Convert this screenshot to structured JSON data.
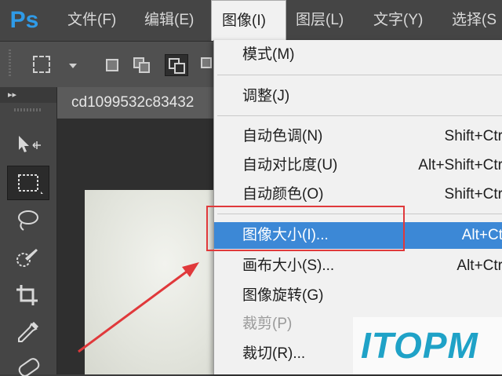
{
  "app": {
    "logo": "Ps"
  },
  "menubar": {
    "items": [
      {
        "label": "文件(F)"
      },
      {
        "label": "编辑(E)"
      },
      {
        "label": "图像(I)"
      },
      {
        "label": "图层(L)"
      },
      {
        "label": "文字(Y)"
      },
      {
        "label": "选择(S"
      }
    ],
    "active_index": 2
  },
  "panel": {
    "collapse_glyph": "▸▸"
  },
  "document": {
    "tab_title": "cd1099532c83432"
  },
  "image_menu": {
    "items": [
      {
        "label": "模式(M)",
        "shortcut": ""
      },
      {
        "label": "调整(J)",
        "shortcut": ""
      },
      {
        "label": "自动色调(N)",
        "shortcut": "Shift+Ctr"
      },
      {
        "label": "自动对比度(U)",
        "shortcut": "Alt+Shift+Ctr"
      },
      {
        "label": "自动颜色(O)",
        "shortcut": "Shift+Ctr"
      },
      {
        "label": "图像大小(I)...",
        "shortcut": "Alt+Ct",
        "highlighted": true
      },
      {
        "label": "画布大小(S)...",
        "shortcut": "Alt+Ctr"
      },
      {
        "label": "图像旋转(G)",
        "shortcut": ""
      },
      {
        "label": "裁剪(P)",
        "shortcut": "",
        "disabled": true
      },
      {
        "label": "裁切(R)...",
        "shortcut": ""
      }
    ]
  },
  "colors": {
    "highlight": "#3c88d6",
    "annotation": "#e0393b",
    "watermark": "#1fa2c7"
  },
  "watermark": {
    "text": "ITOPM"
  }
}
